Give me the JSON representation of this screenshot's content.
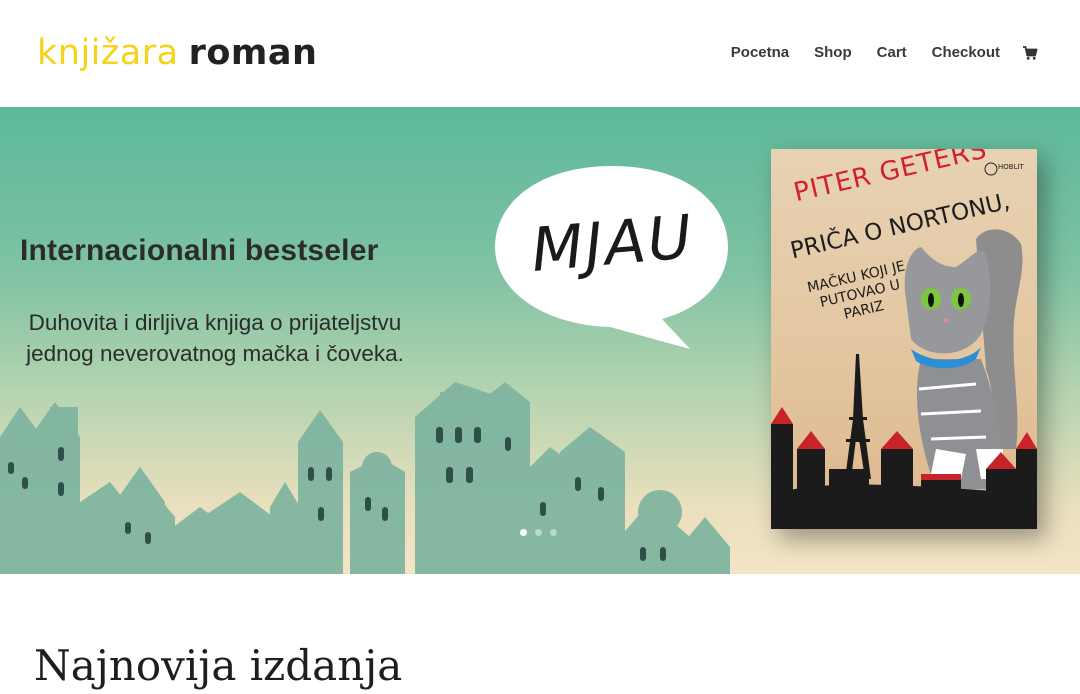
{
  "header": {
    "logo_light": "knjižara",
    "logo_bold": "roman",
    "nav": [
      {
        "label": "Pocetna"
      },
      {
        "label": "Shop"
      },
      {
        "label": "Cart"
      },
      {
        "label": "Checkout"
      }
    ],
    "cart_icon": "shopping-cart-icon"
  },
  "hero": {
    "title": "Internacionalni bestseler",
    "text": "Duhovita i dirljiva knjiga o prijateljstvu jednog neverovatnog mačka i čoveka.",
    "bubble_word": "MJAU",
    "book": {
      "author": "PITER GETERS",
      "title": "PRIČA O NORTONU,",
      "subtitle": "MAČKU KOJI JE PUTOVAO U PARIZ",
      "publisher": "HOBLIT"
    },
    "slider": {
      "count": 3,
      "active": 1
    }
  },
  "section": {
    "title": "Najnovija izdanja"
  },
  "colors": {
    "logo_accent": "#f7d21a",
    "hero_teal": "#5cb89a",
    "hero_sand": "#f3e4c6",
    "book_red": "#d41e2a"
  }
}
